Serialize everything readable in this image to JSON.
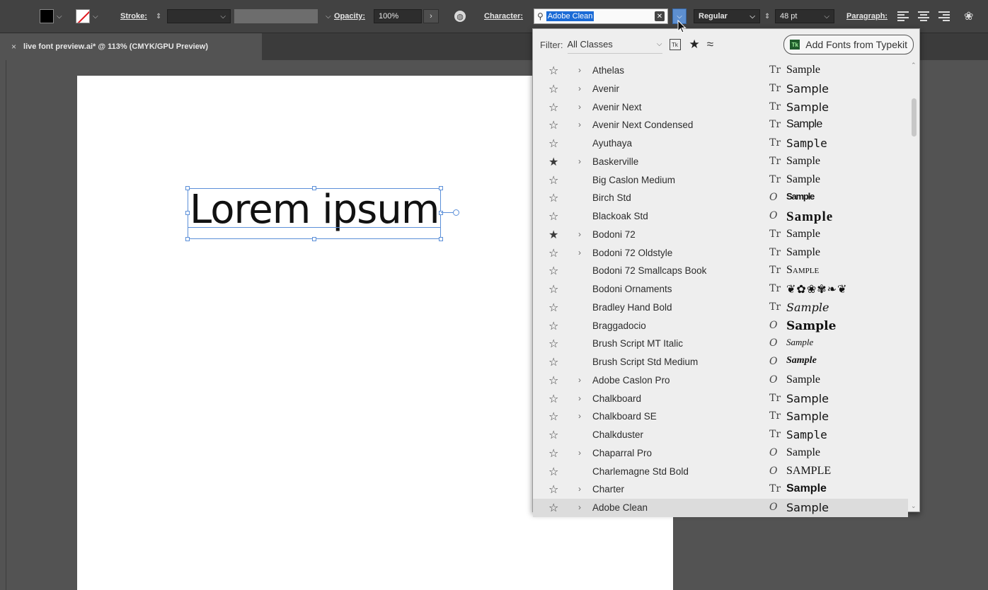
{
  "colors": {
    "accent": "#1b6bd6",
    "frame": "#5b8fd8",
    "stroke_none": "#e0171e",
    "typekit_green": "#1f5c2c"
  },
  "control_bar": {
    "stroke_label": "Stroke:",
    "opacity_label": "Opacity:",
    "opacity_value": "100%",
    "character_label": "Character:",
    "font_search_value": "Adobe Clean",
    "font_style": "Regular",
    "font_size": "48 pt",
    "paragraph_label": "Paragraph:"
  },
  "doc_tab": {
    "close": "×",
    "title": "live font preview.ai* @ 113% (CMYK/GPU Preview)"
  },
  "canvas": {
    "text": "Lorem ipsum"
  },
  "font_panel": {
    "filter_label": "Filter:",
    "filter_value": "All Classes",
    "typekit_icon": "Tk",
    "typekit_button": "Add Fonts from Typekit",
    "fonts": [
      {
        "name": "Athelas",
        "fav": false,
        "expand": true,
        "type": "truetype",
        "sample": "Sample",
        "style": "s-serif"
      },
      {
        "name": "Avenir",
        "fav": false,
        "expand": true,
        "type": "truetype",
        "sample": "Sample",
        "style": "s-sans"
      },
      {
        "name": "Avenir Next",
        "fav": false,
        "expand": true,
        "type": "truetype",
        "sample": "Sample",
        "style": "s-sans"
      },
      {
        "name": "Avenir Next Condensed",
        "fav": false,
        "expand": true,
        "type": "truetype",
        "sample": "Sample",
        "style": "s-narrow"
      },
      {
        "name": "Ayuthaya",
        "fav": false,
        "expand": false,
        "type": "truetype",
        "sample": "Sample",
        "style": "s-mono"
      },
      {
        "name": "Baskerville",
        "fav": true,
        "expand": true,
        "type": "truetype",
        "sample": "Sample",
        "style": "s-serif"
      },
      {
        "name": "Big Caslon Medium",
        "fav": false,
        "expand": false,
        "type": "truetype",
        "sample": "Sample",
        "style": "s-serif"
      },
      {
        "name": "Birch Std",
        "fav": false,
        "expand": false,
        "type": "opentype",
        "sample": "Sample",
        "style": "s-cond"
      },
      {
        "name": "Blackoak Std",
        "fav": false,
        "expand": false,
        "type": "opentype",
        "sample": "Sample",
        "style": "s-black"
      },
      {
        "name": "Bodoni 72",
        "fav": true,
        "expand": true,
        "type": "truetype",
        "sample": "Sample",
        "style": "s-serif"
      },
      {
        "name": "Bodoni 72 Oldstyle",
        "fav": false,
        "expand": true,
        "type": "truetype",
        "sample": "Sample",
        "style": "s-serif"
      },
      {
        "name": "Bodoni 72 Smallcaps Book",
        "fav": false,
        "expand": false,
        "type": "truetype",
        "sample": "Sample",
        "style": "s-smallcaps"
      },
      {
        "name": "Bodoni Ornaments",
        "fav": false,
        "expand": false,
        "type": "truetype",
        "sample": "❦✿❀✾❧❦",
        "style": "s-orn"
      },
      {
        "name": "Bradley Hand Bold",
        "fav": false,
        "expand": false,
        "type": "truetype",
        "sample": "Sample",
        "style": "s-hand"
      },
      {
        "name": "Braggadocio",
        "fav": false,
        "expand": false,
        "type": "opentype",
        "sample": "Sample",
        "style": "s-heavy"
      },
      {
        "name": "Brush Script MT Italic",
        "fav": false,
        "expand": false,
        "type": "opentype",
        "sample": "Sample",
        "style": "s-script"
      },
      {
        "name": "Brush Script Std Medium",
        "fav": false,
        "expand": false,
        "type": "opentype",
        "sample": "Sample",
        "style": "s-scriptb"
      },
      {
        "name": "Adobe Caslon Pro",
        "fav": false,
        "expand": true,
        "type": "opentype",
        "sample": "Sample",
        "style": "s-serif"
      },
      {
        "name": "Chalkboard",
        "fav": false,
        "expand": true,
        "type": "truetype",
        "sample": "Sample",
        "style": "s-sans"
      },
      {
        "name": "Chalkboard SE",
        "fav": false,
        "expand": true,
        "type": "truetype",
        "sample": "Sample",
        "style": "s-sans"
      },
      {
        "name": "Chalkduster",
        "fav": false,
        "expand": false,
        "type": "truetype",
        "sample": "Sample",
        "style": "s-mono"
      },
      {
        "name": "Chaparral Pro",
        "fav": false,
        "expand": true,
        "type": "opentype",
        "sample": "Sample",
        "style": "s-serif"
      },
      {
        "name": "Charlemagne Std Bold",
        "fav": false,
        "expand": false,
        "type": "opentype",
        "sample": "SAMPLE",
        "style": "s-caps"
      },
      {
        "name": "Charter",
        "fav": false,
        "expand": true,
        "type": "truetype",
        "sample": "Sample",
        "style": "s-bold"
      },
      {
        "name": "Adobe Clean",
        "fav": false,
        "expand": true,
        "type": "opentype",
        "sample": "Sample",
        "style": "s-sans"
      }
    ]
  }
}
